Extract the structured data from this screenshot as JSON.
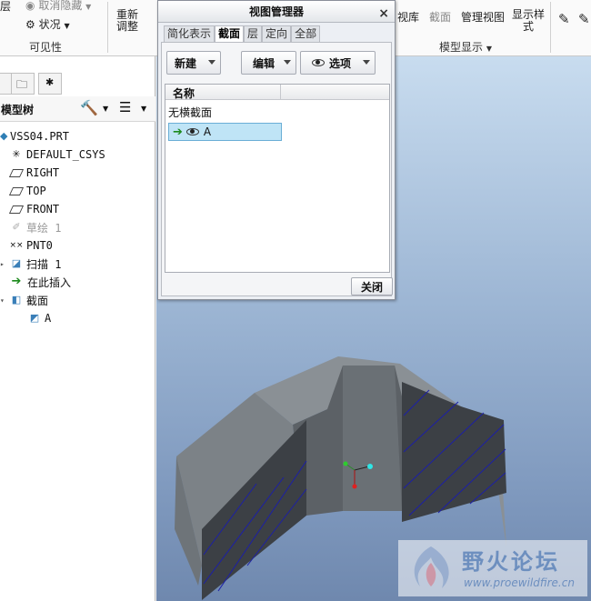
{
  "ribbon": {
    "layer_partial": "层",
    "unhide": "取消隐藏",
    "status": "状况",
    "visibility_group": "可见性",
    "regen_line1": "重新",
    "regen_line2": "调整",
    "view_lib_partial": "视库",
    "section": "截面",
    "manage_views": "管理视图",
    "display_style_line1": "显示样",
    "display_style_line2": "式",
    "model_display_group": "模型显示"
  },
  "model_tree": {
    "title": "模型树",
    "items": [
      {
        "label": "VSS04.PRT"
      },
      {
        "label": "DEFAULT_CSYS"
      },
      {
        "label": "RIGHT"
      },
      {
        "label": "TOP"
      },
      {
        "label": "FRONT"
      },
      {
        "label": "草绘 1"
      },
      {
        "label": "PNT0"
      },
      {
        "label": "扫描 1"
      },
      {
        "label": "在此插入"
      },
      {
        "label": "截面"
      },
      {
        "label": "A"
      }
    ]
  },
  "dialog": {
    "title": "视图管理器",
    "close_x": "×",
    "tabs": [
      {
        "label": "简化表示"
      },
      {
        "label": "截面"
      },
      {
        "label": "层"
      },
      {
        "label": "定向"
      },
      {
        "label": "全部"
      }
    ],
    "new_button": "新建",
    "edit_button": "编辑",
    "options_button": "选项",
    "list_header": "名称",
    "rows": [
      {
        "label": "无横截面"
      },
      {
        "label": "A"
      }
    ],
    "close_button": "关闭"
  },
  "watermark": {
    "text": "野火论坛",
    "url": "www.proewildfire.cn"
  }
}
